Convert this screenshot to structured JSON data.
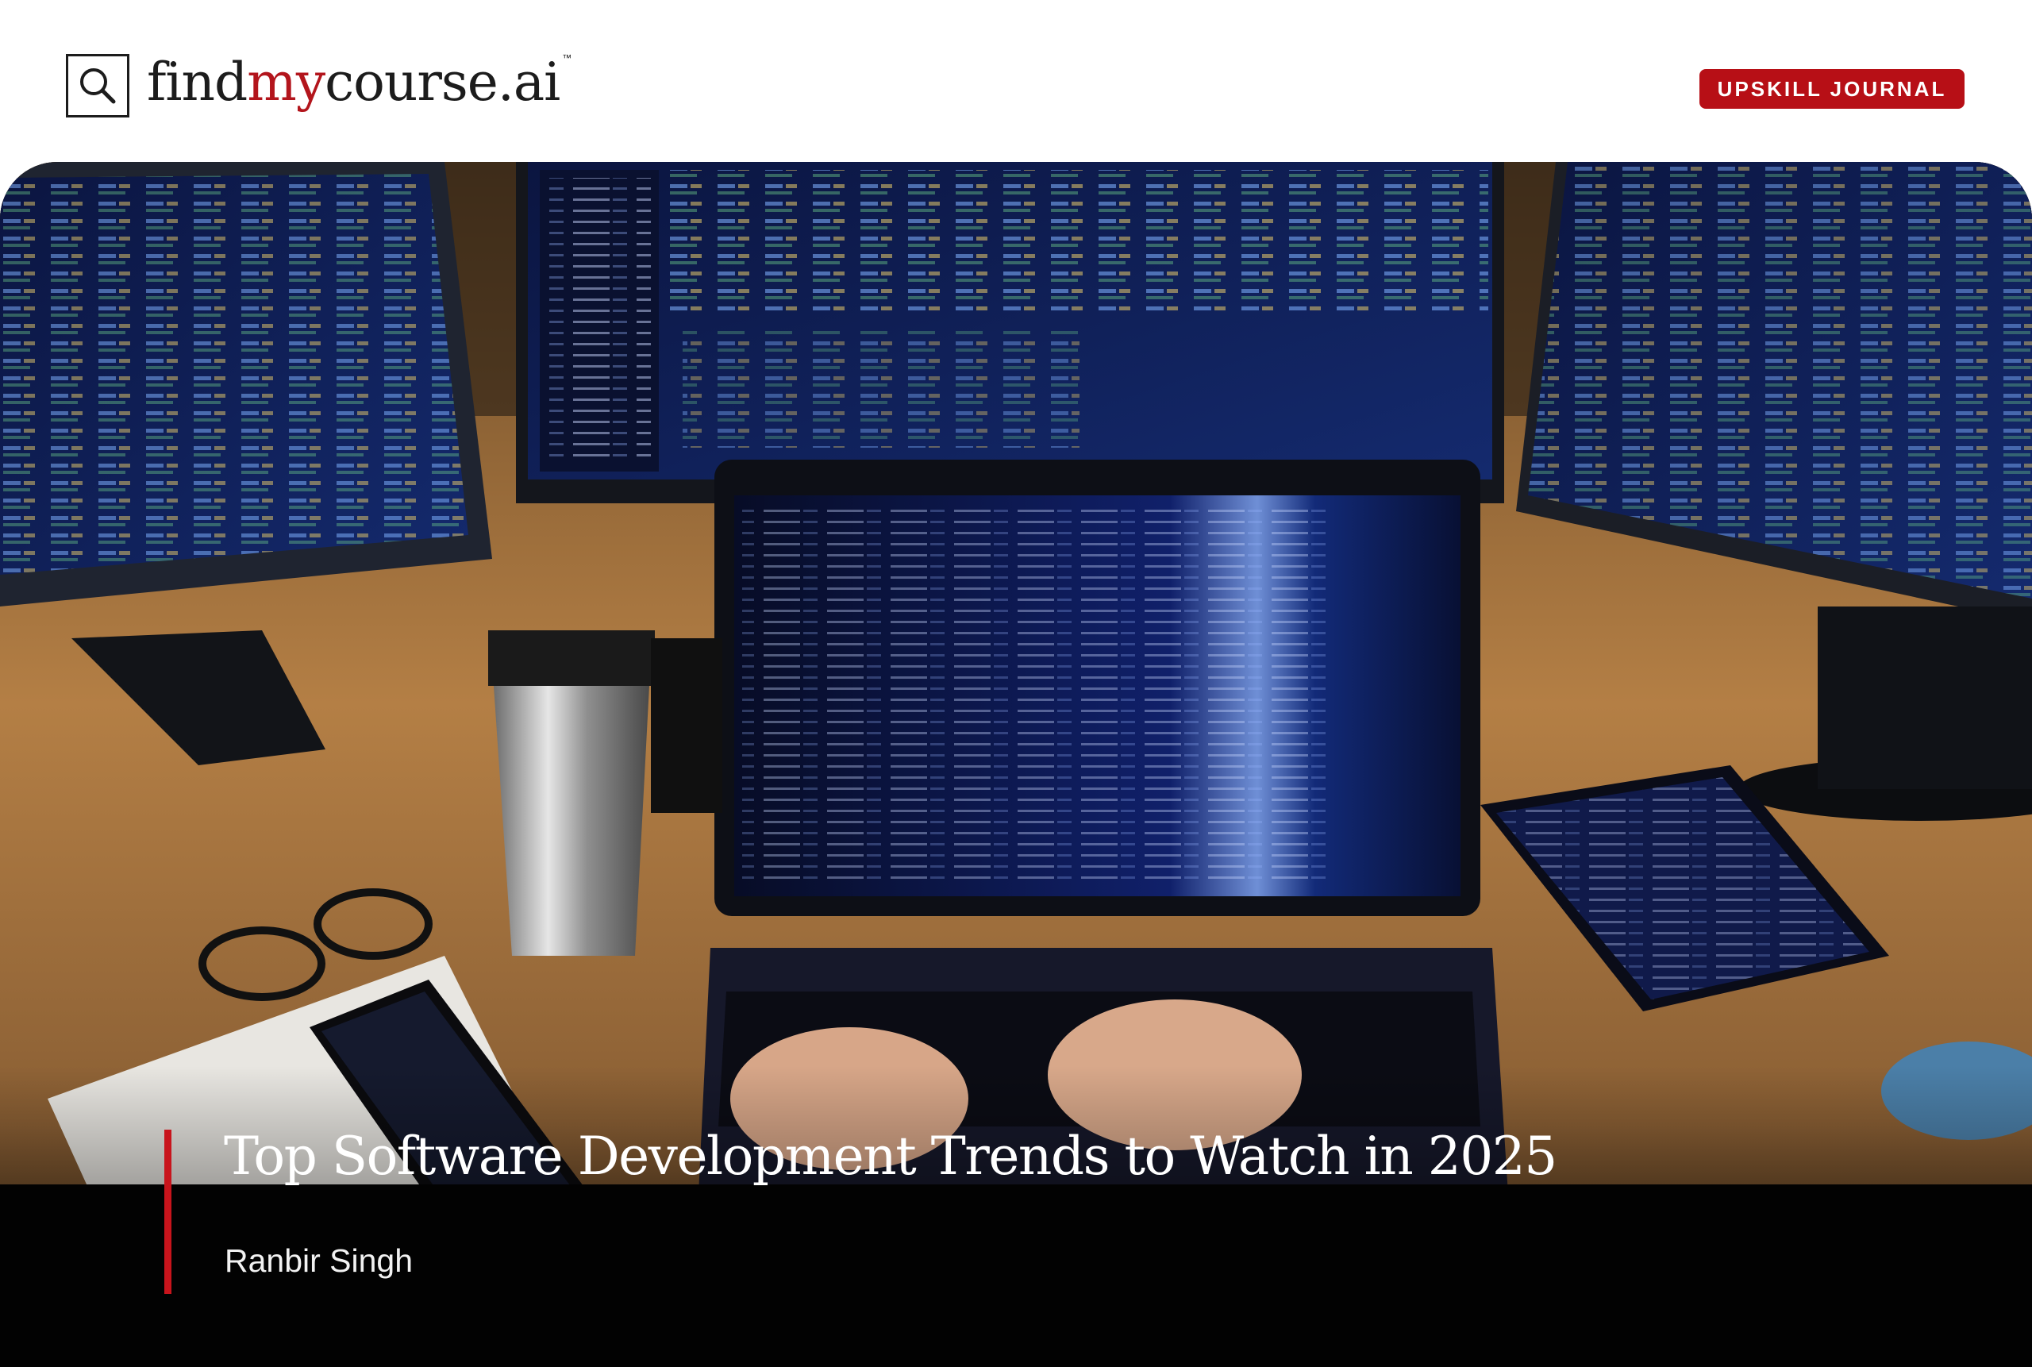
{
  "brand": {
    "name_prefix": "find",
    "name_accent": "my",
    "name_suffix": "course.ai",
    "trademark": "™",
    "accent_color": "#b3151c"
  },
  "header": {
    "badge_label": "UPSKILL JOURNAL",
    "badge_color": "#b70f16"
  },
  "hero": {
    "image_subject": "developer workstation with multiple code monitors and laptop"
  },
  "article": {
    "title": "Top Software Development Trends to Watch in 2025",
    "author": "Ranbir Singh"
  }
}
